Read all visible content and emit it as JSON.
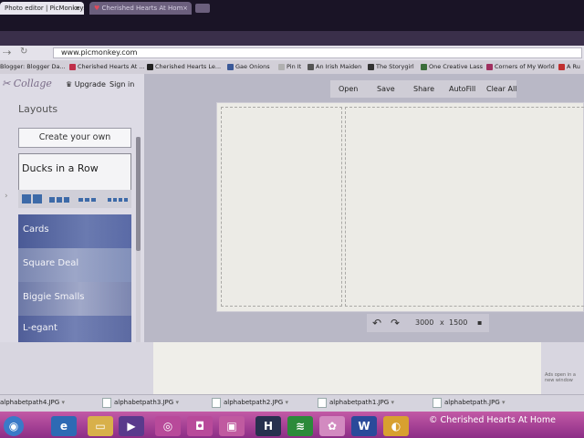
{
  "tabs": [
    {
      "label": "Photo editor | PicMonkey:",
      "active": true
    },
    {
      "label": "Cherished Hearts At Hom",
      "active": false
    }
  ],
  "address": {
    "url": "www.picmonkey.com"
  },
  "bookmarks": [
    {
      "label": "Blogger: Blogger Da...",
      "color": "#e07a2c"
    },
    {
      "label": "Cherished Hearts At ...",
      "color": "#c0304a"
    },
    {
      "label": "Cherished Hearts Le...",
      "color": "#222222"
    },
    {
      "label": "Gae Onions",
      "color": "#3b5998"
    },
    {
      "label": "Pin It",
      "color": "#b0b0b0"
    },
    {
      "label": "An Irish Maiden",
      "color": "#555555"
    },
    {
      "label": "The Storygirl",
      "color": "#333333"
    },
    {
      "label": "One Creative Lass",
      "color": "#3b6e3b"
    },
    {
      "label": "Corners of My World",
      "color": "#a03060"
    },
    {
      "label": "A Ru",
      "color": "#c03030"
    }
  ],
  "app": {
    "logo": "Collage",
    "upgrade": "Upgrade",
    "sign_in": "Sign in",
    "layouts_title": "Layouts",
    "create_button": "Create your own",
    "layouts": [
      {
        "label": "Ducks in a Row"
      },
      {
        "label": "Cards"
      },
      {
        "label": "Square Deal"
      },
      {
        "label": "Biggie Smalls"
      },
      {
        "label": "L-egant"
      }
    ],
    "toolbar": {
      "open": "Open",
      "save": "Save",
      "share": "Share",
      "autofill": "AutoFill",
      "clear_all": "Clear All"
    },
    "canvas_size": {
      "width": "3000",
      "x": "x",
      "height": "1500"
    },
    "popup_note": "Ads open in a new window"
  },
  "downloads": [
    "alphabetpath4.JPG",
    "alphabetpath3.JPG",
    "alphabetpath2.JPG",
    "alphabetpath1.JPG",
    "alphabetpath.JPG"
  ],
  "taskbar": {
    "watermark": "© Cherished Hearts At Home"
  }
}
